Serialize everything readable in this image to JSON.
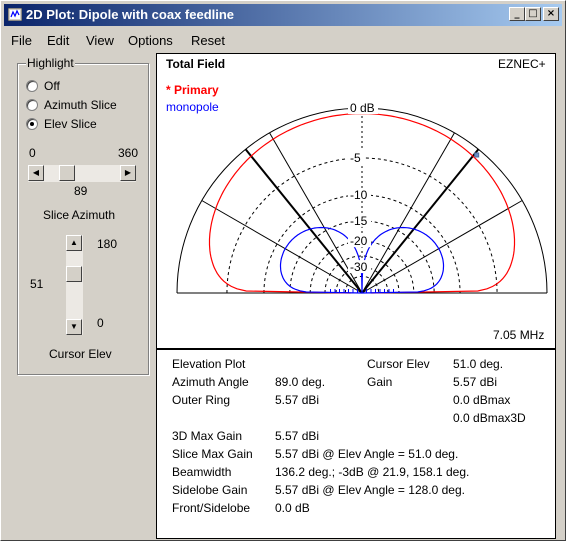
{
  "window": {
    "title": "2D Plot: Dipole with coax feedline",
    "min_glyph": "_",
    "max_glyph": "□",
    "close_glyph": "×"
  },
  "menu": [
    "File",
    "Edit",
    "View",
    "Options",
    "Reset"
  ],
  "highlight": {
    "title": "Highlight",
    "options": [
      "Off",
      "Azimuth Slice",
      "Elev Slice"
    ],
    "selected": "Elev Slice"
  },
  "azimuth_slider": {
    "min_label": "0",
    "max_label": "360",
    "value": "89",
    "value_fraction": 0.247,
    "caption": "Slice Azimuth"
  },
  "elev_slider": {
    "top_label": "180",
    "bottom_label": "0",
    "value": "51",
    "value_fraction": 0.283,
    "caption": "Cursor Elev"
  },
  "plot": {
    "title": "Total Field",
    "brand": "EZNEC+",
    "legend_primary": "* Primary",
    "legend_secondary": "monopole",
    "ring_labels": [
      "0 dB",
      "-5",
      "-10",
      "-15",
      "-20",
      "-30"
    ],
    "frequency": "7.05 MHz",
    "primary_color": "#ff0000",
    "secondary_color": "#0000ff",
    "cursor_elev_deg": 51.0
  },
  "info": {
    "plot_type": "Elevation Plot",
    "cursor_elev_label": "Cursor Elev",
    "cursor_elev_value": "51.0 deg.",
    "azimuth_label": "Azimuth Angle",
    "azimuth_value": "89.0 deg.",
    "gain_label": "Gain",
    "gain_value": "5.57 dBi",
    "outer_ring_label": "Outer Ring",
    "outer_ring_value": "5.57 dBi",
    "dbmax": "0.0 dBmax",
    "dbmax3d": "0.0 dBmax3D",
    "rows": [
      {
        "label": "3D Max Gain",
        "value": "5.57 dBi"
      },
      {
        "label": "Slice Max Gain",
        "value": "5.57 dBi @ Elev Angle = 51.0 deg."
      },
      {
        "label": "Beamwidth",
        "value": "136.2 deg.; -3dB @ 21.9, 158.1 deg."
      },
      {
        "label": "Sidelobe Gain",
        "value": "5.57 dBi @ Elev Angle = 128.0 deg."
      },
      {
        "label": "Front/Sidelobe",
        "value": "0.0 dB"
      }
    ]
  }
}
